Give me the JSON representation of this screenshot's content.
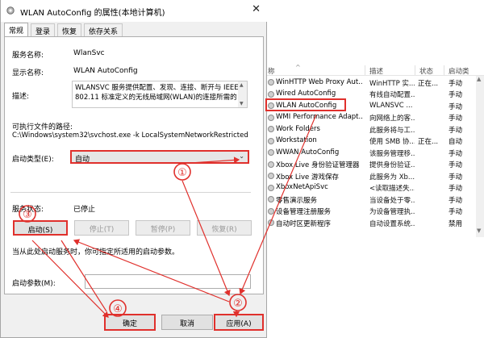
{
  "dialog": {
    "title": "WLAN AutoConfig 的属性(本地计算机)",
    "tabs": [
      "常规",
      "登录",
      "恢复",
      "依存关系"
    ],
    "service_name_label": "服务名称:",
    "service_name_value": "WlanSvc",
    "display_name_label": "显示名称:",
    "display_name_value": "WLAN AutoConfig",
    "description_label": "描述:",
    "description_text": "WLANSVC 服务提供配置、发现、连接、断开与 IEEE 802.11 标准定义的无线局域网(WLAN)的连接所需的",
    "exe_path_label": "可执行文件的路径:",
    "exe_path_value": "C:\\Windows\\system32\\svchost.exe -k LocalSystemNetworkRestricted",
    "startup_type_label": "启动类型(E):",
    "startup_type_value": "自动",
    "service_status_label": "服务状态:",
    "service_status_value": "已停止",
    "buttons": {
      "start": "启动(S)",
      "stop": "停止(T)",
      "pause": "暂停(P)",
      "resume": "恢复(R)"
    },
    "hint_text": "当从此处启动服务时，你可指定所适用的启动参数。",
    "start_params_label": "启动参数(M):",
    "start_params_value": "",
    "footer": {
      "ok": "确定",
      "cancel": "取消",
      "apply": "应用(A)"
    }
  },
  "services": {
    "headers": {
      "name": "称",
      "description": "描述",
      "status": "状态",
      "startup": "启动类"
    },
    "rows": [
      {
        "name": "WinHTTP Web Proxy Aut...",
        "description": "WinHTTP 实...",
        "status": "正在...",
        "startup": "手动"
      },
      {
        "name": "Wired AutoConfig",
        "description": "有线自动配置...",
        "status": "",
        "startup": "手动"
      },
      {
        "name": "WLAN AutoConfig",
        "description": "WLANSVC ...",
        "status": "",
        "startup": "手动"
      },
      {
        "name": "WMI Performance Adapt...",
        "description": "向网络上的客...",
        "status": "",
        "startup": "手动"
      },
      {
        "name": "Work Folders",
        "description": "此服务将与工...",
        "status": "",
        "startup": "手动"
      },
      {
        "name": "Workstation",
        "description": "使用 SMB 协...",
        "status": "正在...",
        "startup": "自动"
      },
      {
        "name": "WWAN AutoConfig",
        "description": "该服务管理移...",
        "status": "",
        "startup": "手动"
      },
      {
        "name": "Xbox Live 身份验证管理器",
        "description": "提供身份验证...",
        "status": "",
        "startup": "手动"
      },
      {
        "name": "Xbox Live 游戏保存",
        "description": "此服务为 Xb...",
        "status": "",
        "startup": "手动"
      },
      {
        "name": "XboxNetApiSvc",
        "description": "<读取描述失...",
        "status": "",
        "startup": "手动"
      },
      {
        "name": "零售演示服务",
        "description": "当设备处于零...",
        "status": "",
        "startup": "手动"
      },
      {
        "name": "设备管理注册服务",
        "description": "为设备管理执...",
        "status": "",
        "startup": "手动"
      },
      {
        "name": "自动时区更新程序",
        "description": "自动设置系统...",
        "status": "",
        "startup": "禁用"
      }
    ]
  },
  "annotations": {
    "marks": [
      "①",
      "②",
      "③",
      "④"
    ]
  },
  "colors": {
    "highlight_red": "#e0302c",
    "dialog_bg": "#f0f0f0",
    "button_bg": "#e1e1e1"
  }
}
